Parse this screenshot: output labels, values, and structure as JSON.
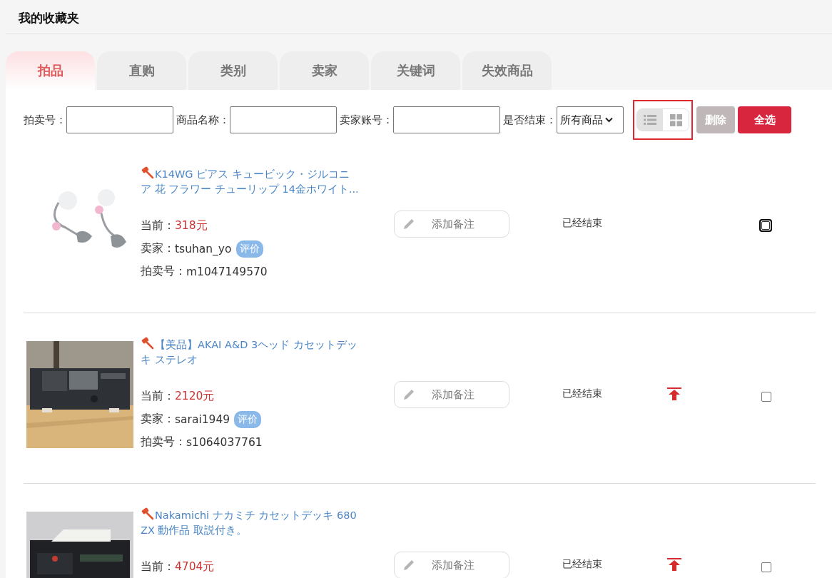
{
  "page_title": "我的收藏夹",
  "tabs": [
    {
      "label": "拍品",
      "selected": true
    },
    {
      "label": "直购",
      "selected": false
    },
    {
      "label": "类别",
      "selected": false
    },
    {
      "label": "卖家",
      "selected": false
    },
    {
      "label": "关键词",
      "selected": false
    },
    {
      "label": "失效商品",
      "selected": false
    }
  ],
  "filters": [
    {
      "kind": "text",
      "label": "拍卖号："
    },
    {
      "kind": "text",
      "label": "商品名称："
    },
    {
      "kind": "text",
      "label": "卖家账号："
    },
    {
      "kind": "select",
      "label": "是否结束：",
      "value": "所有商品"
    }
  ],
  "view_toggle": {
    "highlighted": true,
    "options": [
      {
        "kind": "list",
        "selected": true
      },
      {
        "kind": "grid",
        "selected": false
      }
    ]
  },
  "buttons": [
    {
      "kind": "disabled",
      "label": "删除"
    },
    {
      "kind": "primary",
      "label": "全选"
    }
  ],
  "items": [
    {
      "title": "K14WG ピアス キュービック・ジルコニア 花 フラワー チューリップ 14金ホワイト...",
      "price_label": "当前：",
      "price": "318元",
      "seller_label": "卖家：",
      "seller": "tsuhan_yo",
      "rate": "评价",
      "id_label": "拍卖号：",
      "id": "m1047149570",
      "note": "添加备注",
      "status": "已经结束",
      "top_button": false,
      "checked": false,
      "focused": true
    },
    {
      "title": "【美品】AKAI A&D 3ヘッド カセットデッキ ステレオ",
      "price_label": "当前：",
      "price": "2120元",
      "seller_label": "卖家：",
      "seller": "sarai1949",
      "rate": "评价",
      "id_label": "拍卖号：",
      "id": "s1064037761",
      "note": "添加备注",
      "status": "已经结束",
      "top_button": true,
      "checked": false,
      "focused": false
    },
    {
      "title": "Nakamichi ナカミチ カセットデッキ 680ZX 動作品 取説付き。",
      "price_label": "当前：",
      "price": "4704元",
      "note": "添加备注",
      "status": "已经结束",
      "top_button": true,
      "checked": false,
      "focused": false
    }
  ]
}
